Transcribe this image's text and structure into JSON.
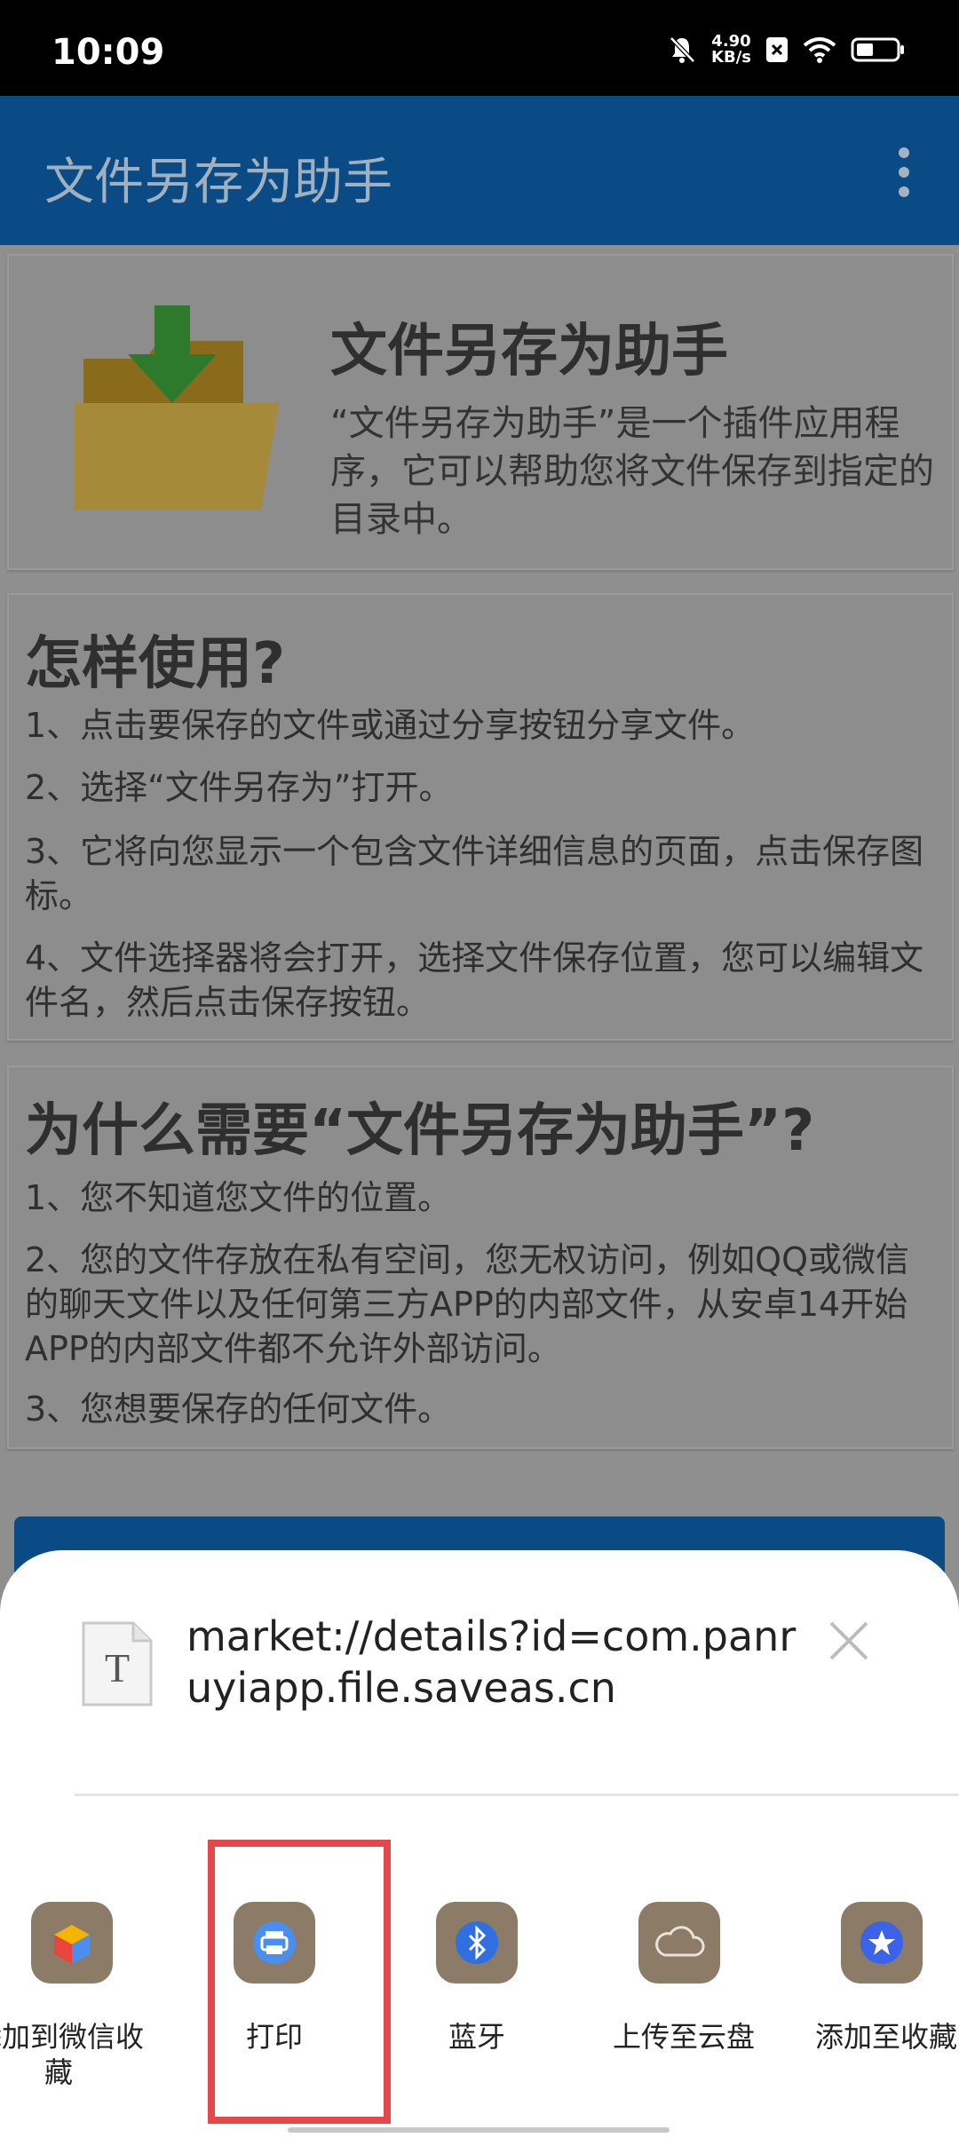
{
  "status_bar": {
    "time": "10:09",
    "net_speed_value": "4.90",
    "net_speed_unit": "KB/s"
  },
  "app_bar": {
    "title": "文件另存为助手"
  },
  "intro_card": {
    "title": "文件另存为助手",
    "description": "“文件另存为助手”是一个插件应用程序，它可以帮助您将文件保存到指定的目录中。"
  },
  "how_to_card": {
    "heading": "怎样使用?",
    "steps": [
      "1、点击要保存的文件或通过分享按钮分享文件。",
      "2、选择“文件另存为”打开。",
      "3、它将向您显示一个包含文件详细信息的页面，点击保存图标。",
      "4、文件选择器将会打开，选择文件保存位置，您可以编辑文件名，然后点击保存按钮。"
    ]
  },
  "why_card": {
    "heading": "为什么需要“文件另存为助手”?",
    "reasons": [
      "1、您不知道您文件的位置。",
      "2、您的文件存放在私有空间，您无权访问，例如QQ或微信的聊天文件以及任何第三方APP的内部文件，从安卓14开始APP的内部文件都不允许外部访问。",
      "3、您想要保存的任何文件。"
    ]
  },
  "share_sheet": {
    "file_icon_letter": "T",
    "shared_text": "market://details?id=com.panruyiapp.file.saveas.cn",
    "targets": [
      {
        "label": "添加到微信收藏",
        "icon": "wechat-favorites-icon"
      },
      {
        "label": "打印",
        "icon": "printer-icon"
      },
      {
        "label": "蓝牙",
        "icon": "bluetooth-icon"
      },
      {
        "label": "上传至云盘",
        "icon": "cloud-icon"
      },
      {
        "label": "添加至收藏",
        "icon": "star-icon"
      }
    ]
  },
  "colors": {
    "app_bar": "#0a4b86",
    "dim_overlay_bg": "#8f8f8f",
    "share_icon_bg": "#8b7b67",
    "highlight_border": "#e5484a"
  }
}
